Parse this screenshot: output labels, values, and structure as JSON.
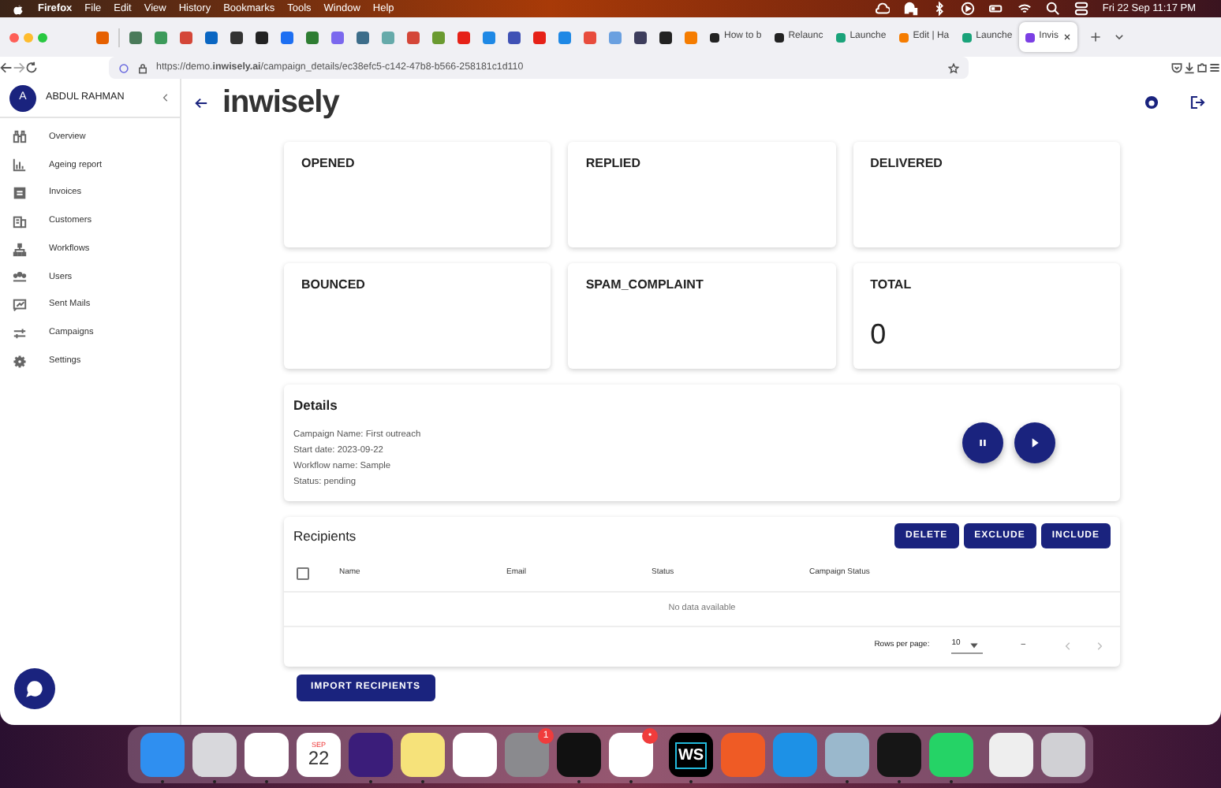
{
  "menu_bar": {
    "app": "Firefox",
    "items": [
      "File",
      "Edit",
      "View",
      "History",
      "Bookmarks",
      "Tools",
      "Window",
      "Help"
    ],
    "clock": "Fri 22 Sep  11:17 PM"
  },
  "browser": {
    "pinned_tabs": [
      {
        "color": "#e66000"
      },
      {
        "color": "#4a7a5a"
      },
      {
        "color": "#3c9a5a"
      },
      {
        "color": "#d44638"
      },
      {
        "color": "#0a66c2"
      },
      {
        "color": "#333333"
      },
      {
        "color": "#222222"
      },
      {
        "color": "#1d6ff2"
      },
      {
        "color": "#2e7d32"
      },
      {
        "color": "#7b68ee"
      },
      {
        "color": "#3d6d8a"
      },
      {
        "color": "#66aaaa"
      },
      {
        "color": "#d44638"
      },
      {
        "color": "#6a9a30"
      },
      {
        "color": "#e62117"
      },
      {
        "color": "#1e88e5"
      },
      {
        "color": "#3f51b5"
      },
      {
        "color": "#e62117"
      },
      {
        "color": "#1e88e5"
      },
      {
        "color": "#e84c3d"
      },
      {
        "color": "#6aa0e0"
      },
      {
        "color": "#3d3d5c"
      },
      {
        "color": "#222222"
      },
      {
        "color": "#f57c00"
      }
    ],
    "tabs": [
      {
        "label": "How to b",
        "color": "#222222",
        "selected": false
      },
      {
        "label": "Relaunc",
        "color": "#222222",
        "selected": false
      },
      {
        "label": "Launche",
        "color": "#1aa37a",
        "selected": false
      },
      {
        "label": "Edit | Ha",
        "color": "#f57c00",
        "selected": false
      },
      {
        "label": "Launche",
        "color": "#1aa37a",
        "selected": false
      },
      {
        "label": "Invis",
        "color": "#7b3fe4",
        "selected": true
      }
    ],
    "url": "https://demo.**inwisely.ai**/campaign_details/ec38efc5-c142-47b8-b566-258181c1d110"
  },
  "sidebar": {
    "avatar": "A",
    "user": "ABDUL RAHMAN",
    "items": [
      {
        "label": "Overview",
        "selected": false
      },
      {
        "label": "Ageing report",
        "selected": false
      },
      {
        "label": "Invoices",
        "selected": false
      },
      {
        "label": "Customers",
        "selected": false
      },
      {
        "label": "Workflows",
        "selected": false
      },
      {
        "label": "Users",
        "selected": false
      },
      {
        "label": "Sent Mails",
        "selected": false
      },
      {
        "label": "Campaigns",
        "selected": false
      },
      {
        "label": "Settings",
        "selected": false
      }
    ]
  },
  "header": {
    "logo": "inwisely"
  },
  "stats": [
    {
      "label": "OPENED"
    },
    {
      "label": "REPLIED"
    },
    {
      "label": "DELIVERED"
    },
    {
      "label": "BOUNCED"
    },
    {
      "label": "SPAM_COMPLAINT"
    },
    {
      "label": "TOTAL",
      "value": "0"
    }
  ],
  "details": {
    "title": "Details",
    "lines": [
      "Campaign Name: First outreach",
      "Start date: 2023-09-22",
      "Workflow name: Sample",
      "Status: pending"
    ]
  },
  "recipients": {
    "title": "Recipients",
    "buttons": [
      "DELETE",
      "EXCLUDE",
      "INCLUDE"
    ],
    "select_all": {
      "checked": false
    },
    "columns": [
      "Name",
      "Email",
      "Status",
      "Campaign Status"
    ],
    "empty": "No data available",
    "rows_per_page_label": "Rows per page:",
    "rows_per_page": "10",
    "range": "–"
  },
  "import_button": "IMPORT RECIPIENTS",
  "dock": [
    {
      "kind": "app",
      "color": "#2f8ff0",
      "running": true
    },
    {
      "kind": "app",
      "color": "#d8d8dc",
      "running": true
    },
    {
      "kind": "app",
      "color": "#ffffff",
      "running": true
    },
    {
      "kind": "calendar",
      "month": "SEP",
      "day": "22",
      "running": false
    },
    {
      "kind": "app",
      "color": "#3b1d7a",
      "running": true
    },
    {
      "kind": "app",
      "color": "#f6e27a",
      "running": true
    },
    {
      "kind": "app",
      "color": "#ffffff",
      "running": false
    },
    {
      "kind": "app",
      "color": "#8a8a8e",
      "running": false,
      "badge": "1"
    },
    {
      "kind": "app",
      "color": "#111111",
      "running": true
    },
    {
      "kind": "app",
      "color": "#ffffff",
      "running": true,
      "badge": "•"
    },
    {
      "kind": "separator"
    },
    {
      "kind": "label",
      "label": "WS",
      "color": "#000000",
      "running": true
    },
    {
      "kind": "app",
      "color": "#ef5b25",
      "running": false
    },
    {
      "kind": "app",
      "color": "#1d91e6",
      "running": false
    },
    {
      "kind": "app",
      "color": "#9ab8cc",
      "running": true
    },
    {
      "kind": "app",
      "color": "#161616",
      "running": true
    },
    {
      "kind": "app",
      "color": "#25d366",
      "running": true
    },
    {
      "kind": "separator"
    },
    {
      "kind": "app",
      "color": "#eeeeee",
      "running": false
    },
    {
      "kind": "app",
      "color": "#d0d0d4",
      "running": false
    }
  ]
}
